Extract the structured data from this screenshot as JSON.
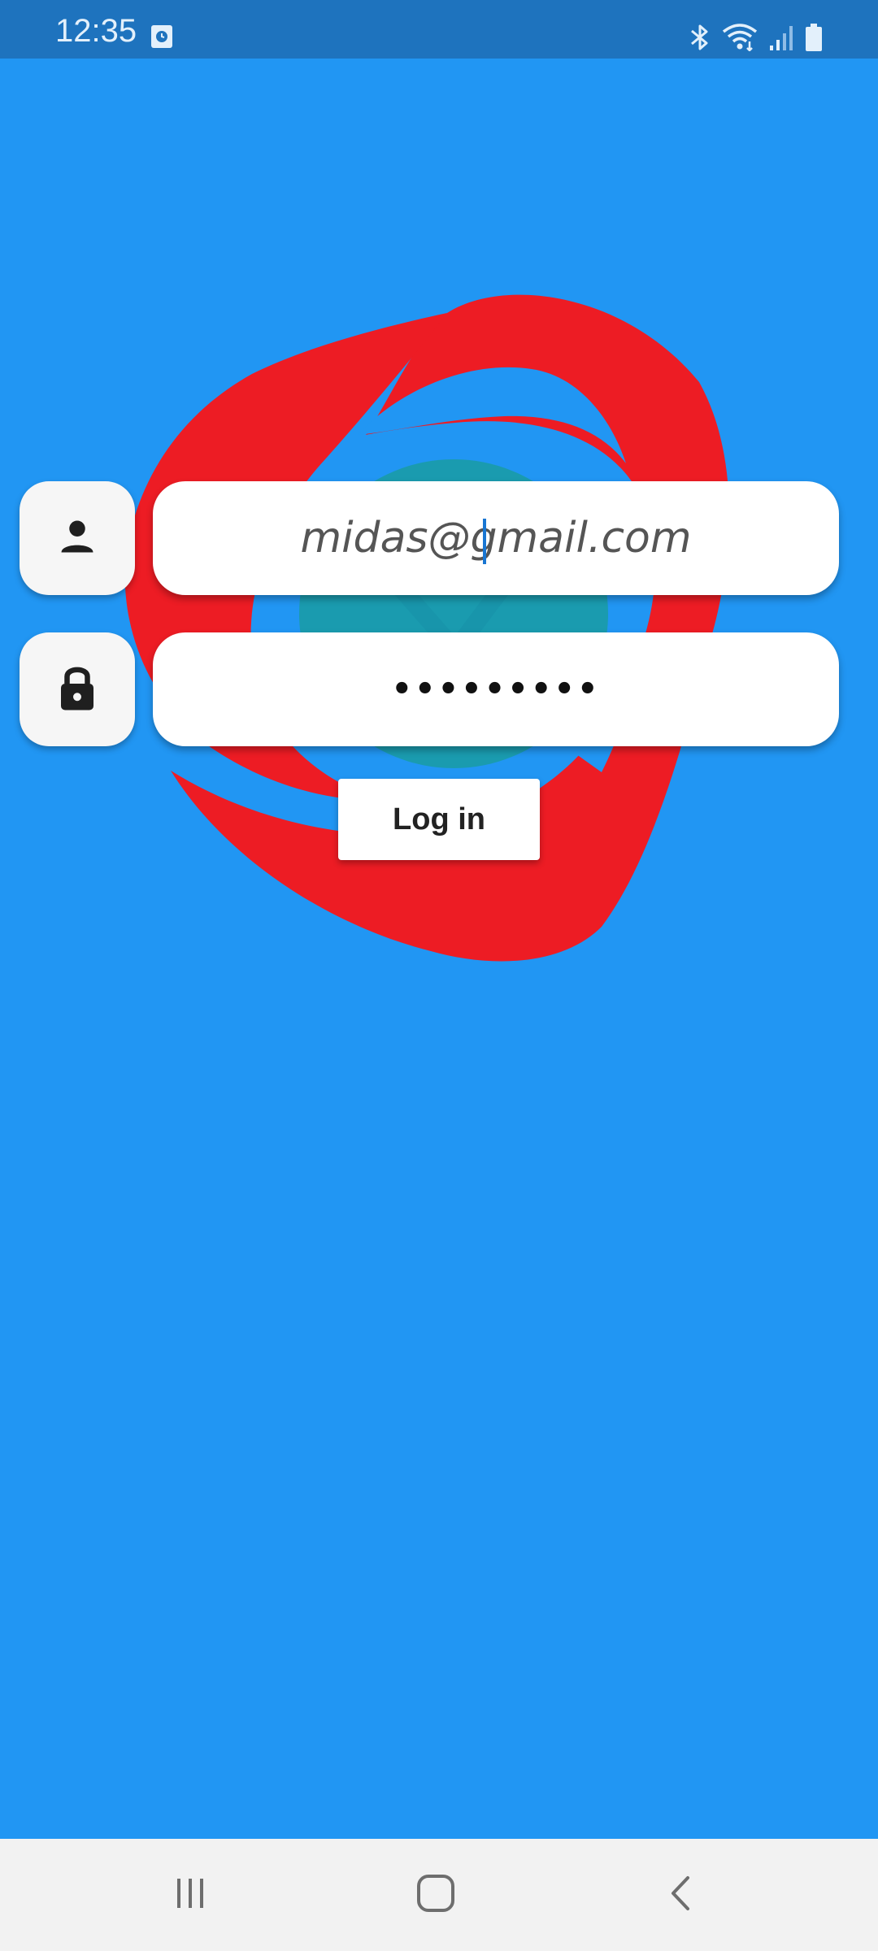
{
  "status_bar": {
    "time": "12:35",
    "left_icon": "screen-time-icon",
    "right_icons": [
      "bluetooth-icon",
      "wifi-icon",
      "cellular-signal-icon",
      "battery-icon"
    ]
  },
  "background": {
    "color": "#2196F3",
    "logo_icon": "brand-logo-icon",
    "logo_colors": [
      "#ED1C24",
      "#1A9BAF"
    ]
  },
  "login_form": {
    "email_icon": "person-icon",
    "email_value": "midas@gmail.com",
    "password_icon": "lock-icon",
    "password_mask": "•••••••••",
    "login_label": "Log in"
  },
  "nav_bar": {
    "buttons": [
      "recent-apps-icon",
      "home-icon",
      "back-icon"
    ]
  }
}
